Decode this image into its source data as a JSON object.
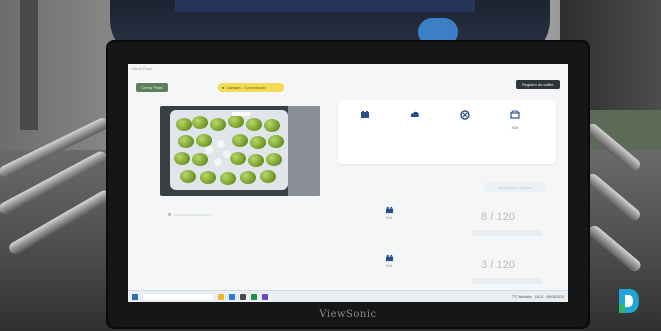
{
  "overlay": {
    "banner_text": ""
  },
  "monitor": {
    "brand": "ViewSonic"
  },
  "app": {
    "title": "Visión Pack",
    "left_button": "Cerrar Pack",
    "status_pill": "Cámara - Conectando",
    "top_right_button": "Registro de calibr."
  },
  "toolbar": {
    "tools": [
      {
        "icon": "camera-icon",
        "label": ""
      },
      {
        "icon": "cloud-sync-icon",
        "label": ""
      },
      {
        "icon": "stop-icon",
        "label": ""
      },
      {
        "icon": "box-icon",
        "label": "XXX"
      }
    ]
  },
  "counters": {
    "tab_label": "Resultados Totales",
    "rows": [
      {
        "icon": "box-icon",
        "code": "XXX",
        "value": "8 / 120"
      },
      {
        "icon": "box-icon",
        "code": "XXX",
        "value": "3 / 120"
      }
    ]
  },
  "side_note": "Comparando imagen",
  "taskbar": {
    "weather": "7°C Nublado",
    "time": "18:21",
    "date": "05/04/2023"
  },
  "colors": {
    "green_button": "#5f7f5b",
    "yellow_pill": "#f3dc55",
    "dark_button": "#2f343a",
    "logo_blue": "#1fa6d6",
    "logo_green": "#38b36a"
  }
}
